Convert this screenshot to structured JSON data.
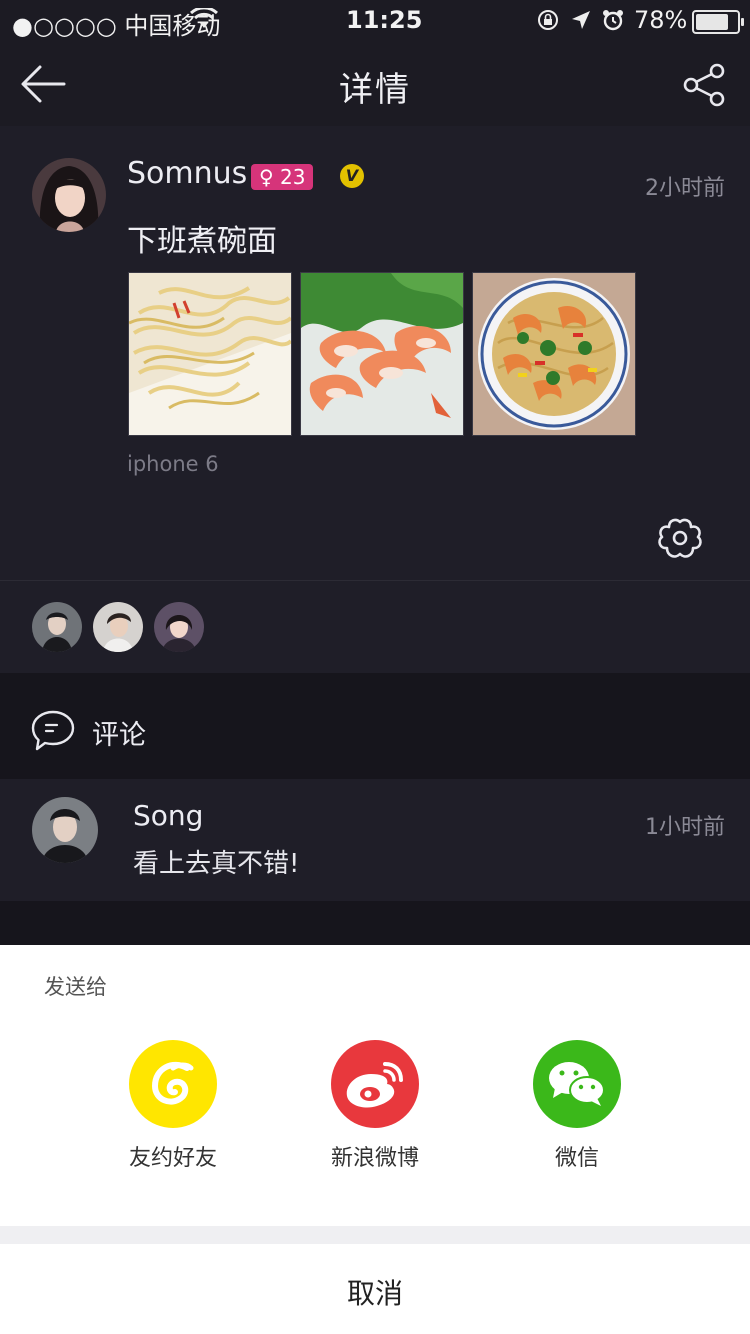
{
  "status": {
    "carrier": "●○○○○ 中国移动",
    "time": "11:25",
    "battery": "78%"
  },
  "nav": {
    "title": "详情"
  },
  "post": {
    "author": "Somnus",
    "gender_age": "♀ 23",
    "verified": "V",
    "time": "2小时前",
    "content": "下班煮碗面",
    "device": "iphone 6",
    "images": [
      "noodles-photo",
      "shrimp-photo",
      "shrimp-pasta-photo"
    ]
  },
  "comments": {
    "header": "评论",
    "items": [
      {
        "author": "Song",
        "time": "1小时前",
        "text": "看上去真不错!"
      }
    ]
  },
  "share": {
    "title": "发送给",
    "items": [
      {
        "label": "友约好友",
        "color": "#ffe600"
      },
      {
        "label": "新浪微博",
        "color": "#e8383d"
      },
      {
        "label": "微信",
        "color": "#3bb81a"
      }
    ],
    "cancel": "取消"
  }
}
